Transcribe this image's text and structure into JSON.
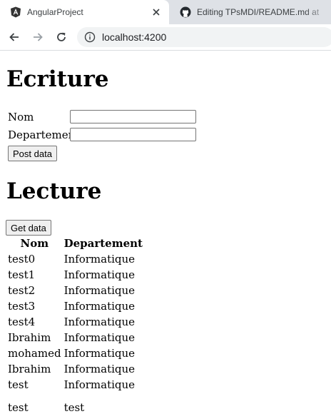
{
  "browser": {
    "tabs": [
      {
        "title": "AngularProject",
        "active": true
      },
      {
        "title": "Editing TPsMDI/README.md at",
        "active": false
      }
    ],
    "address_url": "localhost:4200"
  },
  "page": {
    "ecriture": {
      "heading": "Ecriture",
      "nom_label": "Nom",
      "nom_value": "",
      "departement_label": "Departement",
      "departement_value": "",
      "post_button": "Post data"
    },
    "lecture": {
      "heading": "Lecture",
      "get_button": "Get data",
      "columns": [
        "Nom",
        "Departement"
      ],
      "rows": [
        {
          "nom": "test0",
          "departement": "Informatique"
        },
        {
          "nom": "test1",
          "departement": "Informatique"
        },
        {
          "nom": "test2",
          "departement": "Informatique"
        },
        {
          "nom": "test3",
          "departement": "Informatique"
        },
        {
          "nom": "test4",
          "departement": "Informatique"
        },
        {
          "nom": "Ibrahim",
          "departement": "Informatique"
        },
        {
          "nom": "mohamed",
          "departement": "Informatique"
        },
        {
          "nom": "Ibrahim",
          "departement": "Informatique"
        },
        {
          "nom": "test",
          "departement": "Informatique"
        },
        {
          "nom": "test",
          "departement": "test"
        }
      ]
    }
  },
  "icons": {
    "tab1_favicon": "angular-logo-icon",
    "tab2_favicon": "github-logo-icon",
    "tab_close": "close-icon",
    "back": "back-arrow-icon",
    "forward": "forward-arrow-icon",
    "reload": "reload-icon",
    "site_info": "info-icon"
  },
  "colors": {
    "tabstrip": "#dee1e6",
    "omnibox": "#f1f3f4",
    "angular": "#dd0031"
  }
}
